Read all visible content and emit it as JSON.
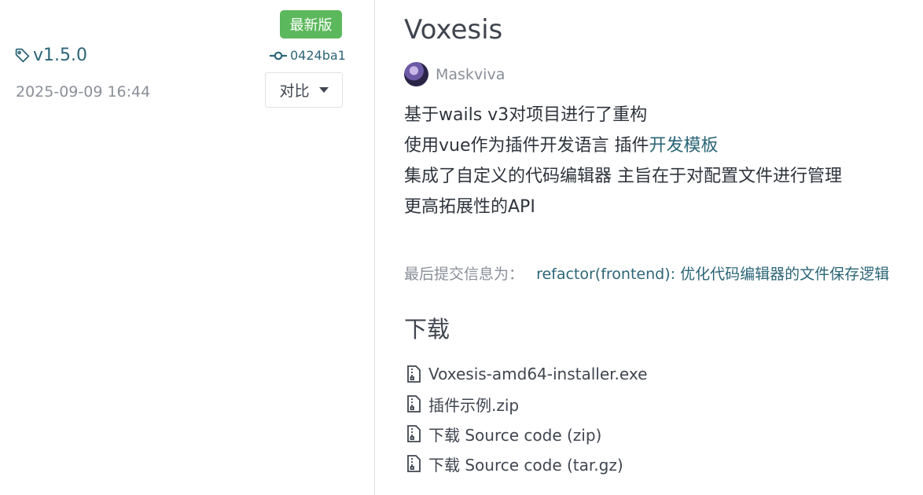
{
  "release": {
    "latest_badge": "最新版",
    "tag": "v1.5.0",
    "commit": "0424ba1",
    "date": "2025-09-09 16:44",
    "compare_label": "对比"
  },
  "main": {
    "title": "Voxesis",
    "author": "Maskviva",
    "notes": {
      "line1": "基于wails v3对项目进行了重构",
      "line2_prefix": "使用vue作为插件开发语言 插件",
      "line2_link": "开发模板",
      "line3": "集成了自定义的代码编辑器 主旨在于对配置文件进行管理",
      "line4": "更高拓展性的API"
    },
    "last_commit_label": "最后提交信息为：",
    "last_commit_message": "refactor(frontend): 优化代码编辑器的文件保存逻辑",
    "downloads_title": "下载",
    "downloads": [
      "Voxesis-amd64-installer.exe",
      "插件示例.zip",
      "下载 Source code (zip)",
      "下载 Source code (tar.gz)"
    ]
  },
  "icons": [
    "tag-icon",
    "commit-icon",
    "caret-down-icon",
    "file-zip-icon"
  ],
  "colors": {
    "badge": "#5cb85c",
    "link": "#2b6577",
    "muted": "#8a8f98"
  }
}
